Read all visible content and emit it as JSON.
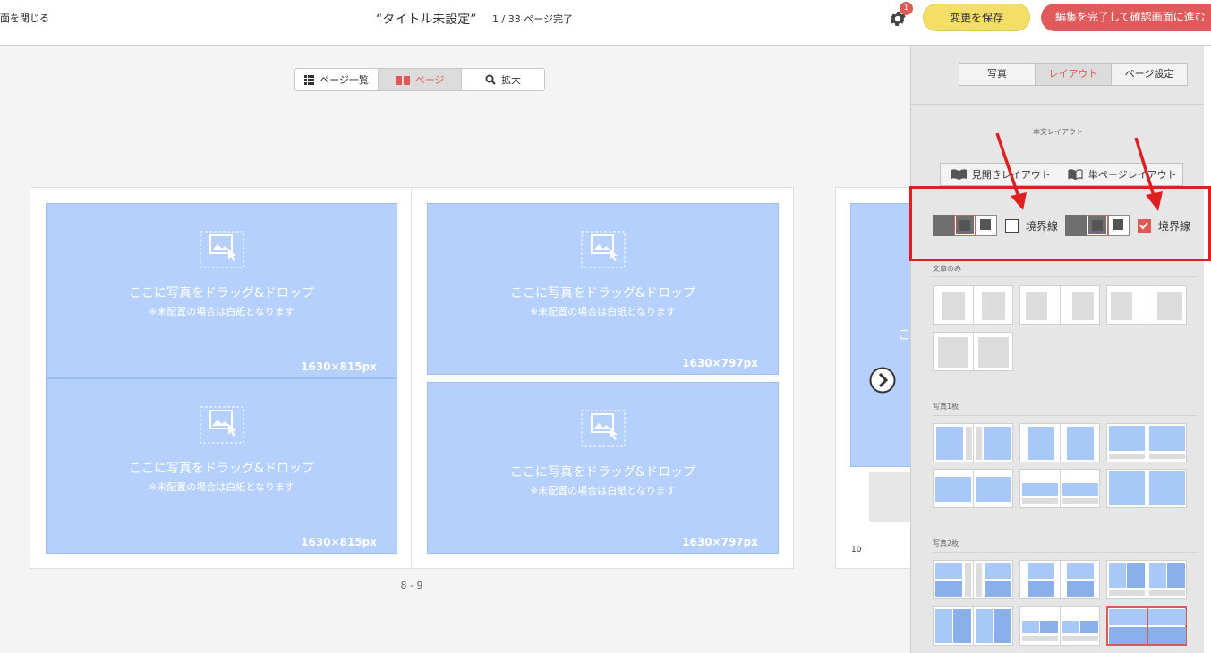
{
  "header": {
    "close_label": "面を閉じる",
    "title": "“タイトル未設定”",
    "progress": "1 / 33 ページ完了",
    "notification_count": "1",
    "save_label": "変更を保存",
    "finish_label": "編集を完了して確認画面に進む"
  },
  "view_tabs": [
    {
      "label": "ページ一覧",
      "icon": "grid-icon"
    },
    {
      "label": "ページ",
      "icon": "book-icon",
      "active": true
    },
    {
      "label": "拡大",
      "icon": "search-icon"
    }
  ],
  "placeholder": {
    "main": "ここに写真をドラッグ&ドロップ",
    "sub": "※未配置の場合は白紙となります"
  },
  "spread": {
    "label": "8 - 9",
    "slots": [
      {
        "size": "1630×815px"
      },
      {
        "size": "1630×815px"
      },
      {
        "size": "1630×797px"
      },
      {
        "size": "1630×797px"
      }
    ]
  },
  "next_page": {
    "page_number": "10",
    "peek_text": "こ"
  },
  "panel": {
    "tabs": [
      {
        "label": "写真"
      },
      {
        "label": "レイアウト",
        "active": true
      },
      {
        "label": "ページ設定"
      }
    ],
    "heading": "本文レイアウト",
    "layout_tabs": [
      {
        "label": "見開きレイアウト",
        "icon": "book-open-icon"
      },
      {
        "label": "単ページレイアウト",
        "icon": "book-open-icon"
      }
    ],
    "border_options": [
      {
        "label": "境界線",
        "checked": false
      },
      {
        "label": "境界線",
        "checked": true
      }
    ],
    "sections": [
      {
        "label": "文章のみ"
      },
      {
        "label": "写真1枚"
      },
      {
        "label": "写真2枚"
      }
    ]
  },
  "colors": {
    "accent": "#e05a55",
    "save": "#f3df68",
    "finish": "#df5b5b",
    "slot": "#b5d0fc",
    "annotation": "#e02020"
  }
}
